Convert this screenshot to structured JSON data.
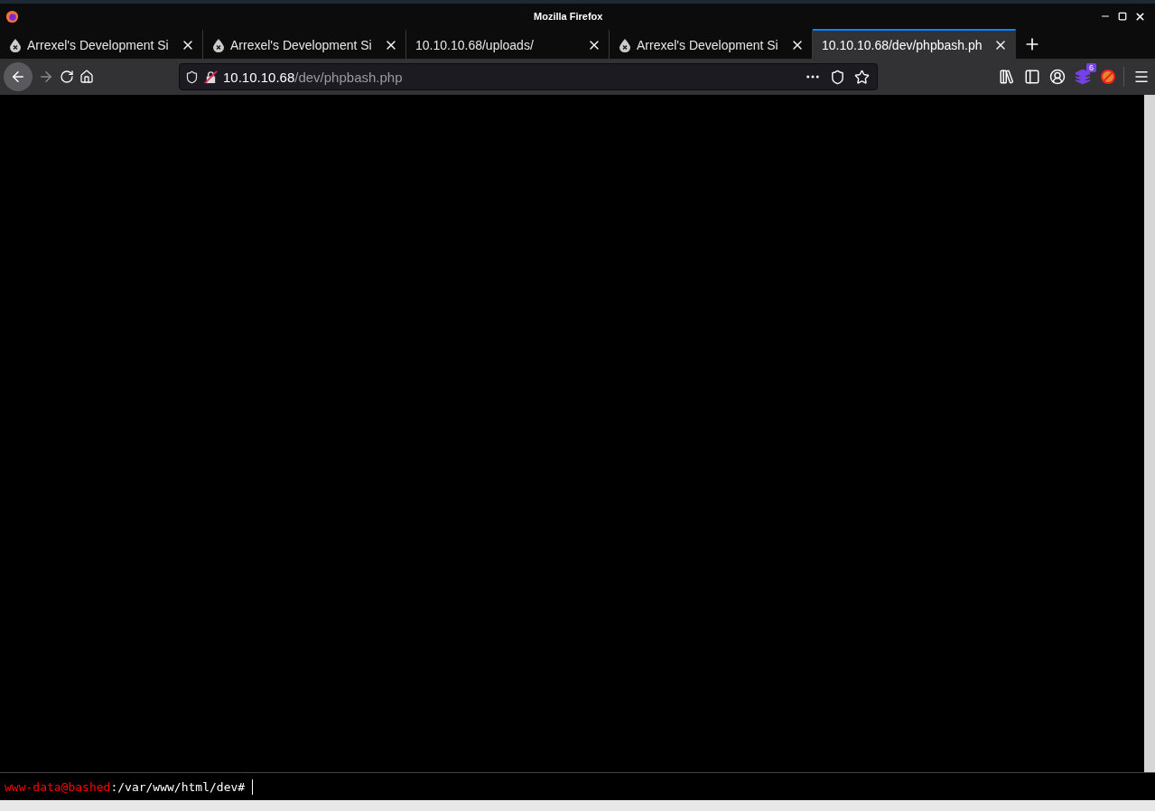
{
  "window": {
    "title": "Mozilla Firefox"
  },
  "tabs": [
    {
      "label": "Arrexel's Development Si",
      "selected": false,
      "favicon": true
    },
    {
      "label": "Arrexel's Development Si",
      "selected": false,
      "favicon": true
    },
    {
      "label": "10.10.10.68/uploads/",
      "selected": false,
      "favicon": false
    },
    {
      "label": "Arrexel's Development Si",
      "selected": false,
      "favicon": true
    },
    {
      "label": "10.10.10.68/dev/phpbash.ph",
      "selected": true,
      "favicon": false
    }
  ],
  "url": {
    "host": "10.10.10.68",
    "path": "/dev/phpbash.php"
  },
  "extension_badge": "6",
  "terminal": {
    "user": "www-data@bashed",
    "path": ":/var/www/html/dev#"
  }
}
